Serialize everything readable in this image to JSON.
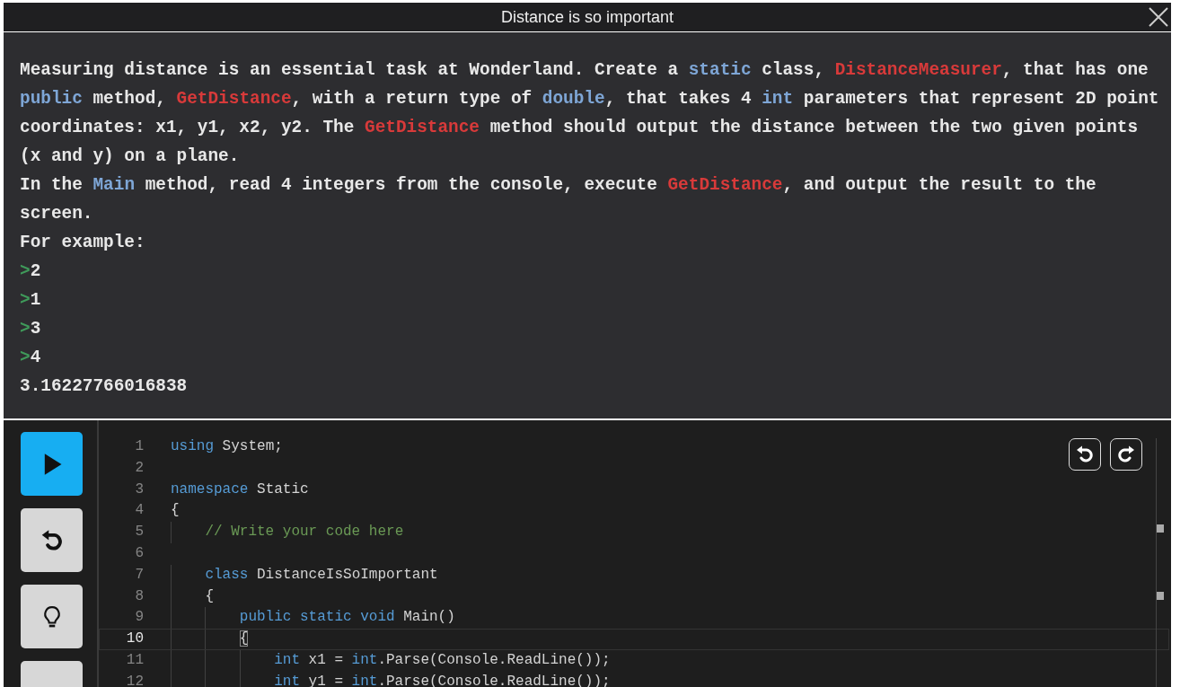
{
  "window": {
    "title": "Distance is so important"
  },
  "description": {
    "paragraphs": [
      [
        {
          "kind": "text",
          "text": "Measuring distance is an essential task at Wonderland. Create a "
        },
        {
          "kind": "keyword",
          "text": "static"
        },
        {
          "kind": "text",
          "text": " class, "
        },
        {
          "kind": "name",
          "text": "DistanceMeasurer"
        },
        {
          "kind": "text",
          "text": ", that has one "
        },
        {
          "kind": "keyword",
          "text": "public"
        },
        {
          "kind": "text",
          "text": " method, "
        },
        {
          "kind": "name",
          "text": "GetDistance"
        },
        {
          "kind": "text",
          "text": ", with a return type of "
        },
        {
          "kind": "keyword",
          "text": "double"
        },
        {
          "kind": "text",
          "text": ", that takes 4 "
        },
        {
          "kind": "keyword",
          "text": "int"
        },
        {
          "kind": "text",
          "text": " parameters that represent 2D point coordinates: x1, y1, x2, y2. The "
        },
        {
          "kind": "name",
          "text": "GetDistance"
        },
        {
          "kind": "text",
          "text": " method should output the distance between the two given points (x and y) on a plane."
        }
      ],
      [
        {
          "kind": "text",
          "text": "In the "
        },
        {
          "kind": "keyword",
          "text": "Main"
        },
        {
          "kind": "text",
          "text": " method, read 4 integers from the console, execute "
        },
        {
          "kind": "name",
          "text": "GetDistance"
        },
        {
          "kind": "text",
          "text": ", and output the result to the screen."
        }
      ],
      [
        {
          "kind": "text",
          "text": "For example:"
        }
      ]
    ],
    "example": [
      {
        "kind": "input",
        "prompt": ">",
        "text": "2"
      },
      {
        "kind": "input",
        "prompt": ">",
        "text": "1"
      },
      {
        "kind": "input",
        "prompt": ">",
        "text": "3"
      },
      {
        "kind": "input",
        "prompt": ">",
        "text": "4"
      },
      {
        "kind": "output",
        "text": "3.16227766016838"
      }
    ]
  },
  "sidebar": {
    "buttons": [
      {
        "kind": "run"
      },
      {
        "kind": "reset"
      },
      {
        "kind": "hint"
      },
      {
        "kind": "other"
      }
    ]
  },
  "editor": {
    "lines": [
      {
        "number": "1",
        "current": false,
        "tokens": [
          {
            "kind": "keyword",
            "text": "using"
          },
          {
            "kind": "plain",
            "text": " System;"
          }
        ]
      },
      {
        "number": "2",
        "current": false
      },
      {
        "number": "3",
        "current": false,
        "tokens": [
          {
            "kind": "keyword",
            "text": "namespace"
          },
          {
            "kind": "plain",
            "text": " Static"
          }
        ]
      },
      {
        "number": "4",
        "current": false,
        "tokens": [
          {
            "kind": "plain",
            "text": "{"
          }
        ]
      },
      {
        "number": "5",
        "current": false,
        "tokens": [
          {
            "kind": "comment",
            "text": "    // Write your code here"
          }
        ]
      },
      {
        "number": "6",
        "current": false
      },
      {
        "number": "7",
        "current": false,
        "tokens": [
          {
            "kind": "keyword",
            "text": "    class"
          },
          {
            "kind": "plain",
            "text": " DistanceIsSoImportant"
          }
        ]
      },
      {
        "number": "8",
        "current": false,
        "tokens": [
          {
            "kind": "plain",
            "text": "    {"
          }
        ]
      },
      {
        "number": "9",
        "current": false,
        "tokens": [
          {
            "kind": "keyword",
            "text": "        public static void"
          },
          {
            "kind": "plain",
            "text": " Main()"
          }
        ]
      },
      {
        "number": "10",
        "current": true,
        "tokens": [
          {
            "kind": "match",
            "text": "        {"
          }
        ]
      },
      {
        "number": "11",
        "current": false,
        "tokens": [
          {
            "kind": "keyword",
            "text": "            int"
          },
          {
            "kind": "plain",
            "text": " x1 = "
          },
          {
            "kind": "keyword",
            "text": "int"
          },
          {
            "kind": "plain",
            "text": ".Parse(Console.ReadLine());"
          }
        ]
      },
      {
        "number": "12",
        "current": false,
        "tokens": [
          {
            "kind": "keyword",
            "text": "            int"
          },
          {
            "kind": "plain",
            "text": " y1 = "
          },
          {
            "kind": "keyword",
            "text": "int"
          },
          {
            "kind": "plain",
            "text": ".Parse(Console.ReadLine());"
          }
        ]
      }
    ]
  }
}
